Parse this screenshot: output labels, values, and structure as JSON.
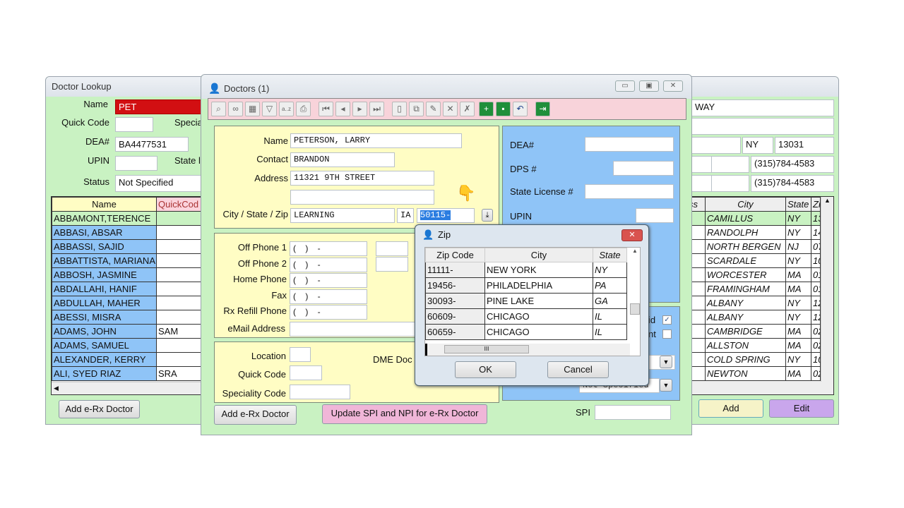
{
  "lookup": {
    "title": "Doctor Lookup",
    "fields": {
      "name_label": "Name",
      "name_value": "PET",
      "quick_code_label": "Quick Code",
      "special_label": "Specia",
      "dea_label": "DEA#",
      "dea_value": "BA4477531",
      "upin_label": "UPIN",
      "state_label": "State l",
      "status_label": "Status",
      "status_value": "Not Specified"
    },
    "columns": [
      "Name",
      "QuickCod"
    ],
    "rows": [
      [
        "ABBAMONT,TERENCE",
        ""
      ],
      [
        "ABBASI, ABSAR",
        ""
      ],
      [
        "ABBASSI, SAJID",
        ""
      ],
      [
        "ABBATTISTA, MARIANA",
        ""
      ],
      [
        "ABBOSH, JASMINE",
        ""
      ],
      [
        "ABDALLAHI, HANIF",
        ""
      ],
      [
        "ABDULLAH, MAHER",
        ""
      ],
      [
        "ABESSI, MISRA",
        ""
      ],
      [
        "ADAMS, JOHN",
        "SAM"
      ],
      [
        "ADAMS, SAMUEL",
        ""
      ],
      [
        "ALEXANDER, KERRY",
        ""
      ],
      [
        "ALI, SYED RIAZ",
        "SRA"
      ]
    ],
    "add_erx": "Add e-Rx Doctor"
  },
  "right": {
    "address": "WAY",
    "state": "NY",
    "zip": "13031",
    "phone1": "(315)784-4583",
    "phone2": "(315)784-4583",
    "columns": [
      "ss",
      "City",
      "State",
      "Zi"
    ],
    "rows": [
      [
        "CAMILLUS",
        "NY",
        "13"
      ],
      [
        "RANDOLPH",
        "NY",
        "14"
      ],
      [
        "NORTH BERGEN",
        "NJ",
        "07"
      ],
      [
        "SCARDALE",
        "NY",
        "10"
      ],
      [
        "WORCESTER",
        "MA",
        "01"
      ],
      [
        "FRAMINGHAM",
        "MA",
        "01"
      ],
      [
        "ALBANY",
        "NY",
        "12"
      ],
      [
        "ALBANY",
        "NY",
        "12"
      ],
      [
        "CAMBRIDGE",
        "MA",
        "02"
      ],
      [
        "ALLSTON",
        "MA",
        "02"
      ],
      [
        "COLD SPRING",
        "NY",
        "10"
      ],
      [
        "NEWTON",
        "MA",
        "02"
      ]
    ],
    "add": "Add",
    "edit": "Edit"
  },
  "doctors": {
    "title": "Doctors (1)",
    "name_label": "Name",
    "name": "PETERSON, LARRY",
    "contact_label": "Contact",
    "contact": "BRANDON",
    "address_label": "Address",
    "address1": "11321 9TH STREET",
    "address2": "",
    "csz_label": "City / State / Zip",
    "city": "LEARNING",
    "state": "IA",
    "zip": "50115-",
    "dea_label": "DEA#",
    "dps_label": "DPS #",
    "license_label": "State License #",
    "upin_label": "UPIN",
    "phones": [
      {
        "label": "Off Phone 1",
        "value": "(    )    -"
      },
      {
        "label": "Off Phone 2",
        "value": "(    )    -"
      },
      {
        "label": "Home Phone",
        "value": "(    )    -"
      },
      {
        "label": "Fax",
        "value": "(    )    -"
      },
      {
        "label": "Rx Refill Phone",
        "value": "(    )    -"
      }
    ],
    "email_label": "eMail Address",
    "location_label": "Location",
    "quick_code_label": "Quick Code",
    "speciality_label": "Speciality Code",
    "dme_label": "DME Doc",
    "check1_label": "id",
    "check1": true,
    "check2_label": "nt",
    "check2": false,
    "status_value": "Not Specified",
    "spi_label": "SPI",
    "add_erx": "Add e-Rx Doctor",
    "update_spi": "Update SPI and NPI for e-Rx Doctor"
  },
  "zip_dialog": {
    "title": "Zip",
    "columns": [
      "Zip Code",
      "City",
      "State"
    ],
    "rows": [
      [
        "11111-",
        "NEW YORK",
        "NY"
      ],
      [
        "19456-",
        "PHILADELPHIA",
        "PA"
      ],
      [
        "30093-",
        "PINE LAKE",
        "GA"
      ],
      [
        "60609-",
        "CHICAGO",
        "IL"
      ],
      [
        "60659-",
        "CHICAGO",
        "IL"
      ]
    ],
    "ok": "OK",
    "cancel": "Cancel"
  }
}
